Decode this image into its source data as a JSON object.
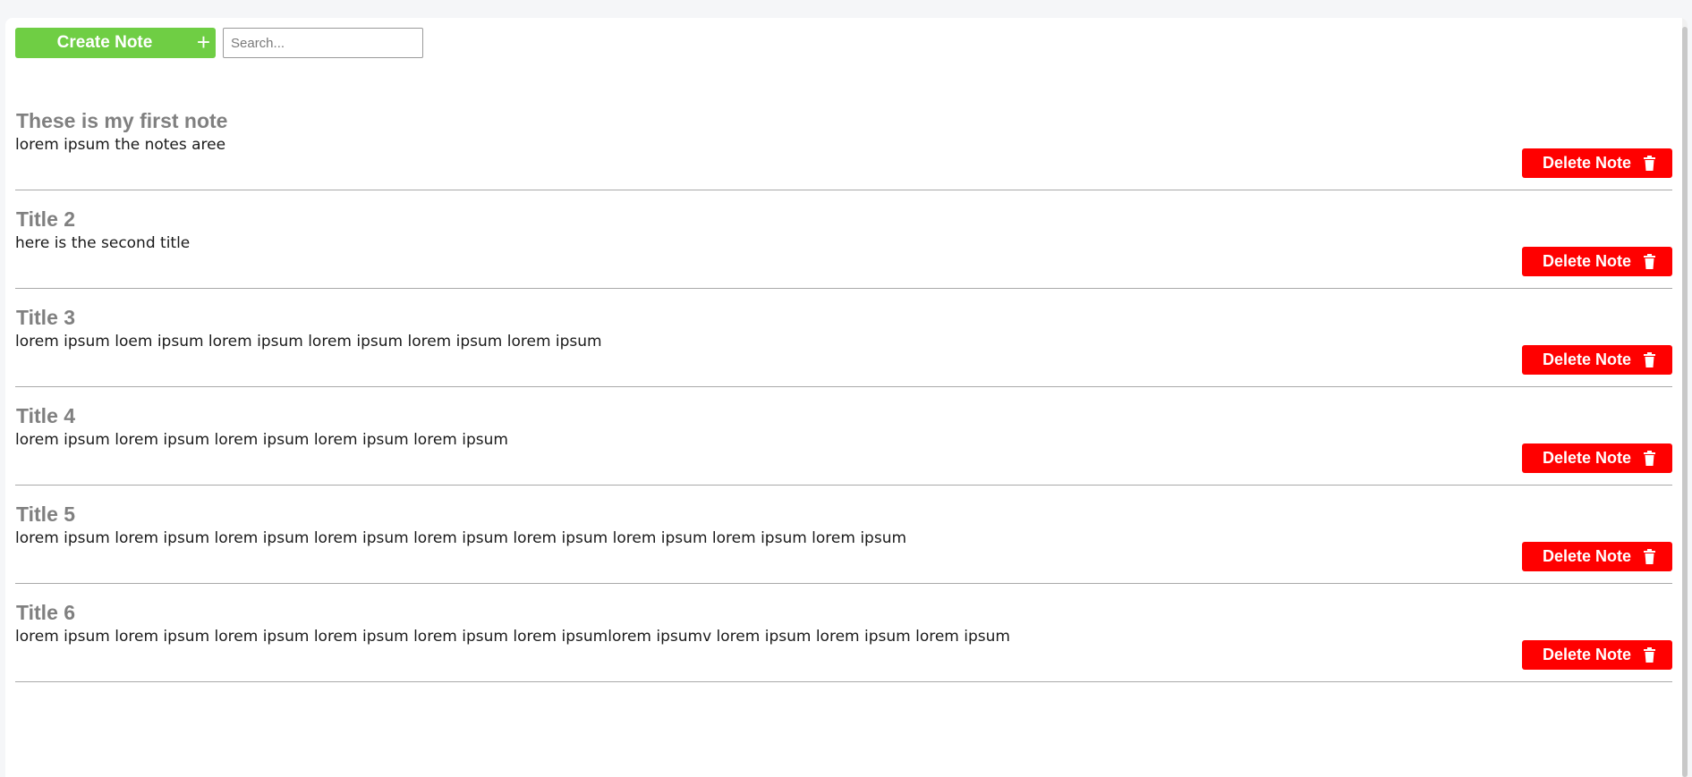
{
  "toolbar": {
    "create_label": "Create Note",
    "create_icon": "plus-icon",
    "create_icon_glyph": "+",
    "search_placeholder": "Search...",
    "search_value": ""
  },
  "notes": [
    {
      "title": "These is my first note",
      "body": "lorem ipsum the notes aree",
      "delete_label": "Delete Note"
    },
    {
      "title": "Title 2",
      "body": "here is the second title",
      "delete_label": "Delete Note"
    },
    {
      "title": "Title 3",
      "body": "lorem ipsum loem ipsum lorem ipsum lorem ipsum lorem ipsum lorem ipsum",
      "delete_label": "Delete Note"
    },
    {
      "title": "Title 4",
      "body": "lorem ipsum lorem ipsum lorem ipsum lorem ipsum lorem ipsum",
      "delete_label": "Delete Note"
    },
    {
      "title": "Title 5",
      "body": "lorem ipsum lorem ipsum lorem ipsum lorem ipsum lorem ipsum lorem ipsum lorem ipsum lorem ipsum lorem ipsum",
      "delete_label": "Delete Note"
    },
    {
      "title": "Title 6",
      "body": "lorem ipsum lorem ipsum lorem ipsum lorem ipsum lorem ipsum lorem ipsumlorem ipsumv lorem ipsum lorem ipsum lorem ipsum",
      "delete_label": "Delete Note"
    }
  ],
  "icons": {
    "delete": "trash-icon",
    "create": "plus-icon"
  },
  "colors": {
    "create_button": "#6fce44",
    "delete_button": "#ff0000",
    "title_text": "#808080",
    "divider": "#a9a9a9"
  }
}
